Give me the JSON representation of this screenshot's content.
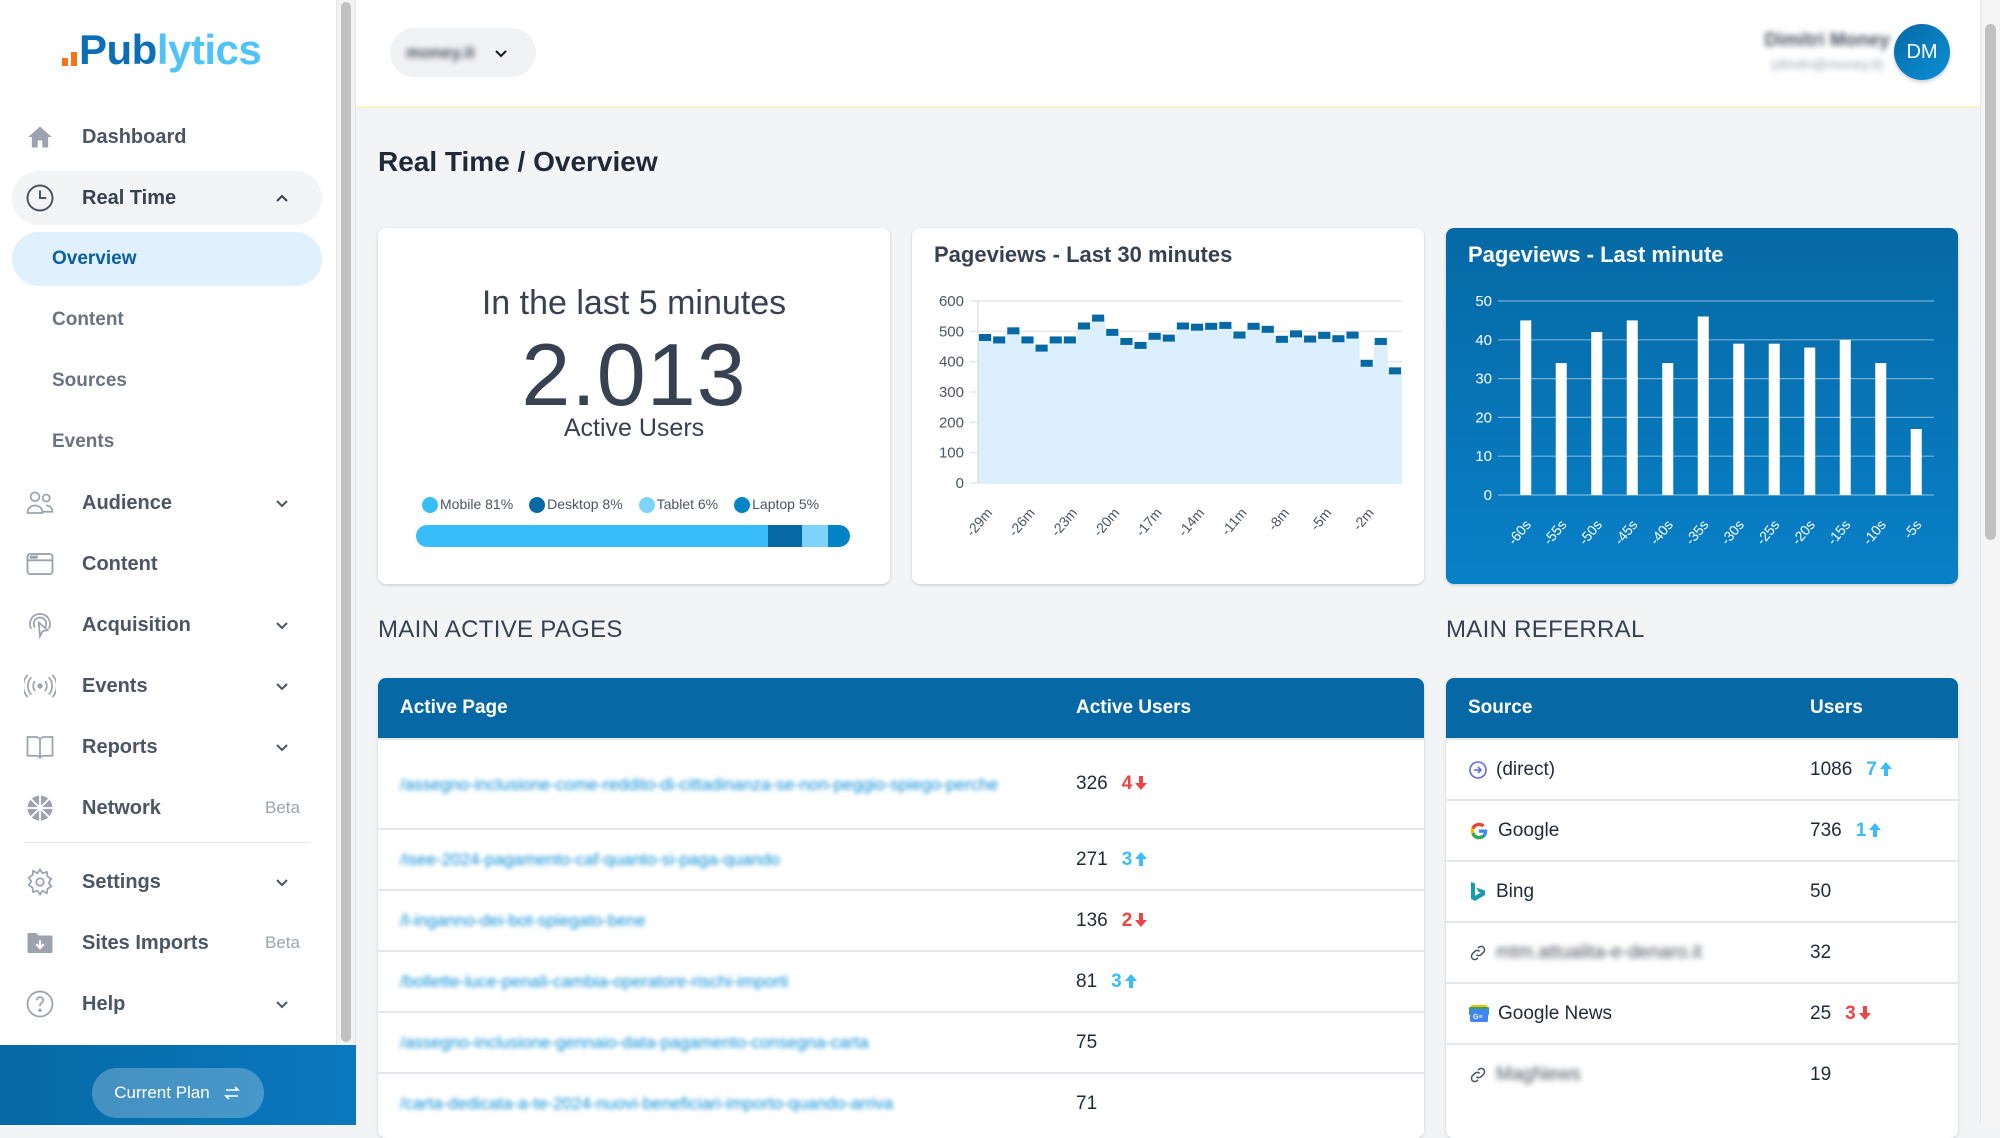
{
  "app": {
    "name_part1": "Pub",
    "name_part2": "lytics"
  },
  "sidebar": {
    "items": [
      {
        "label": "Dashboard",
        "icon": "home-icon"
      },
      {
        "label": "Real Time",
        "icon": "clock-icon",
        "expanded": true
      },
      {
        "label": "Audience",
        "icon": "users-icon"
      },
      {
        "label": "Content",
        "icon": "browser-window-icon"
      },
      {
        "label": "Acquisition",
        "icon": "cursor-signal-icon"
      },
      {
        "label": "Events",
        "icon": "broadcast-icon"
      },
      {
        "label": "Reports",
        "icon": "book-icon"
      },
      {
        "label": "Network",
        "icon": "globe-icon",
        "badge": "Beta"
      },
      {
        "label": "Settings",
        "icon": "gear-icon"
      },
      {
        "label": "Sites Imports",
        "icon": "folder-download-icon",
        "badge": "Beta"
      },
      {
        "label": "Help",
        "icon": "question-circle-icon"
      }
    ],
    "realtime_sub": [
      "Overview",
      "Content",
      "Sources",
      "Events"
    ],
    "active_sub": "Overview",
    "plan_button": "Current Plan"
  },
  "topbar": {
    "site": "money.it",
    "user_name": "Dimitri Money",
    "user_email": "(dimitri@money.it)",
    "avatar_initials": "DM"
  },
  "page": {
    "title": "Real Time / Overview"
  },
  "active_users": {
    "subtitle": "In the last 5 minutes",
    "count": "2.013",
    "label": "Active Users",
    "devices": [
      {
        "name": "Mobile",
        "pct": 81,
        "label": "Mobile 81%",
        "color": "#38bdf8"
      },
      {
        "name": "Desktop",
        "pct": 8,
        "label": "Desktop 8%",
        "color": "#0669a5"
      },
      {
        "name": "Tablet",
        "pct": 6,
        "label": "Tablet 6%",
        "color": "#7dd3fc"
      },
      {
        "name": "Laptop",
        "pct": 5,
        "label": "Laptop 5%",
        "color": "#0284c7"
      }
    ]
  },
  "chart_data": [
    {
      "type": "area",
      "title": "Pageviews - Last 30 minutes",
      "xlabel": "",
      "ylabel": "",
      "ylim": [
        0,
        600
      ],
      "yticks": [
        0,
        100,
        200,
        300,
        400,
        500,
        600
      ],
      "x": [
        "-29m",
        "-28m",
        "-27m",
        "-26m",
        "-25m",
        "-24m",
        "-23m",
        "-22m",
        "-21m",
        "-20m",
        "-19m",
        "-18m",
        "-17m",
        "-16m",
        "-15m",
        "-14m",
        "-13m",
        "-12m",
        "-11m",
        "-10m",
        "-9m",
        "-8m",
        "-7m",
        "-6m",
        "-5m",
        "-4m",
        "-3m",
        "-2m",
        "-1m",
        "0m"
      ],
      "xtick_labels": [
        "-29m",
        "-26m",
        "-23m",
        "-20m",
        "-17m",
        "-14m",
        "-11m",
        "-8m",
        "-5m",
        "-2m"
      ],
      "values": [
        478,
        470,
        500,
        470,
        443,
        470,
        470,
        516,
        542,
        495,
        465,
        452,
        482,
        476,
        516,
        512,
        515,
        518,
        486,
        515,
        505,
        472,
        490,
        473,
        485,
        474,
        486,
        393,
        465,
        368
      ],
      "grid": true,
      "colors": {
        "line": "#0669a5",
        "fill": "#dbeffc"
      }
    },
    {
      "type": "bar",
      "title": "Pageviews - Last minute",
      "xlabel": "",
      "ylabel": "",
      "ylim": [
        0,
        50
      ],
      "yticks": [
        0,
        10,
        20,
        30,
        40,
        50
      ],
      "categories": [
        "-60s",
        "-55s",
        "-50s",
        "-45s",
        "-40s",
        "-35s",
        "-30s",
        "-25s",
        "-20s",
        "-15s",
        "-10s",
        "-5s"
      ],
      "values": [
        45,
        34,
        42,
        45,
        34,
        46,
        39,
        39,
        38,
        40,
        34,
        17
      ],
      "grid": true,
      "colors": {
        "bar": "#ffffff",
        "background": "#0669a5"
      }
    }
  ],
  "active_pages": {
    "section_title": "MAIN ACTIVE PAGES",
    "headers": [
      "Active Page",
      "Active Users"
    ],
    "rows": [
      {
        "url": "/assegno-inclusione-come-reddito-di-cittadinanza-se-non-peggio-spiego-perche",
        "users": "326",
        "delta": "4",
        "dir": "down"
      },
      {
        "url": "/isee-2024-pagamento-caf-quanto-si-paga-quando",
        "users": "271",
        "delta": "3",
        "dir": "up"
      },
      {
        "url": "/l-inganno-dei-bot-spiegato-bene",
        "users": "136",
        "delta": "2",
        "dir": "down"
      },
      {
        "url": "/bollette-luce-penali-cambia-operatore-rischi-importi",
        "users": "81",
        "delta": "3",
        "dir": "up"
      },
      {
        "url": "/assegno-inclusione-gennaio-data-pagamento-consegna-carta",
        "users": "75",
        "delta": "",
        "dir": ""
      },
      {
        "url": "/carta-dedicata-a-te-2024-nuovi-beneficiari-importo-quando-arriva",
        "users": "71",
        "delta": "",
        "dir": ""
      }
    ]
  },
  "referrals": {
    "section_title": "MAIN REFERRAL",
    "headers": [
      "Source",
      "Users"
    ],
    "rows": [
      {
        "source": "(direct)",
        "icon": "direct-arrow-icon",
        "users": "1086",
        "delta": "7",
        "dir": "up"
      },
      {
        "source": "Google",
        "icon": "google-icon",
        "users": "736",
        "delta": "1",
        "dir": "up"
      },
      {
        "source": "Bing",
        "icon": "bing-icon",
        "users": "50",
        "delta": "",
        "dir": ""
      },
      {
        "source": "mtm.attualita-e-denaro.it",
        "icon": "link-icon",
        "users": "32",
        "delta": "",
        "dir": "",
        "blurred": true
      },
      {
        "source": "Google News",
        "icon": "google-news-icon",
        "users": "25",
        "delta": "3",
        "dir": "down"
      },
      {
        "source": "MagNews",
        "icon": "link-icon",
        "users": "19",
        "delta": "",
        "dir": "",
        "blurred": true
      }
    ]
  }
}
